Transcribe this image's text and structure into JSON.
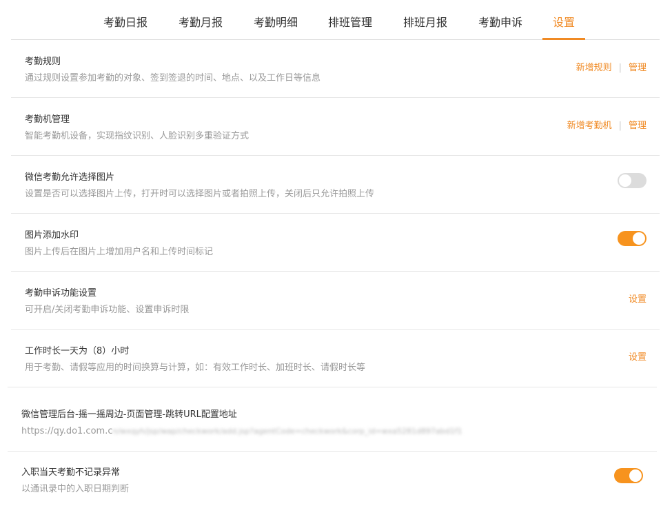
{
  "tabs": [
    {
      "label": "考勤日报",
      "active": false
    },
    {
      "label": "考勤月报",
      "active": false
    },
    {
      "label": "考勤明细",
      "active": false
    },
    {
      "label": "排班管理",
      "active": false
    },
    {
      "label": "排班月报",
      "active": false
    },
    {
      "label": "考勤申诉",
      "active": false
    },
    {
      "label": "设置",
      "active": true
    }
  ],
  "accent_color": "#f08a24",
  "settings": [
    {
      "title": "考勤规则",
      "desc": "通过规则设置参加考勤的对象、签到签退的时间、地点、以及工作日等信息",
      "add_link": "新增规则",
      "manage_link": "管理",
      "separator": "|"
    },
    {
      "title": "考勤机管理",
      "desc": "智能考勤机设备，实现指纹识别、人脸识别多重验证方式",
      "add_link": "新增考勤机",
      "manage_link": "管理",
      "separator": "|"
    },
    {
      "title": "微信考勤允许选择图片",
      "desc": "设置是否可以选择图片上传，打开时可以选择图片或者拍照上传，关闭后只允许拍照上传",
      "toggle_on": false
    },
    {
      "title": "图片添加水印",
      "desc": "图片上传后在图片上增加用户名和上传时间标记",
      "toggle_on": true
    },
    {
      "title": "考勤申诉功能设置",
      "desc": "可开启/关闭考勤申诉功能、设置申诉时限",
      "action_link": "设置"
    },
    {
      "title": "工作时长一天为（8）小时",
      "desc": "用于考勤、请假等应用的时间换算与计算，如：有效工作时长、加班时长、请假时长等",
      "action_link": "设置"
    },
    {
      "title": "微信管理后台-摇一摇周边-页面管理-跳转URL配置地址",
      "url_visible": "https://qy.do1.com.c",
      "url_blurred": "n/wxqyh/jsp/wap/checkwork/add.jsp?agentCode=checkwork&corp_id=wxa5281d897abd1f1"
    },
    {
      "title": "入职当天考勤不记录异常",
      "desc": "以通讯录中的入职日期判断",
      "toggle_on": true
    }
  ]
}
